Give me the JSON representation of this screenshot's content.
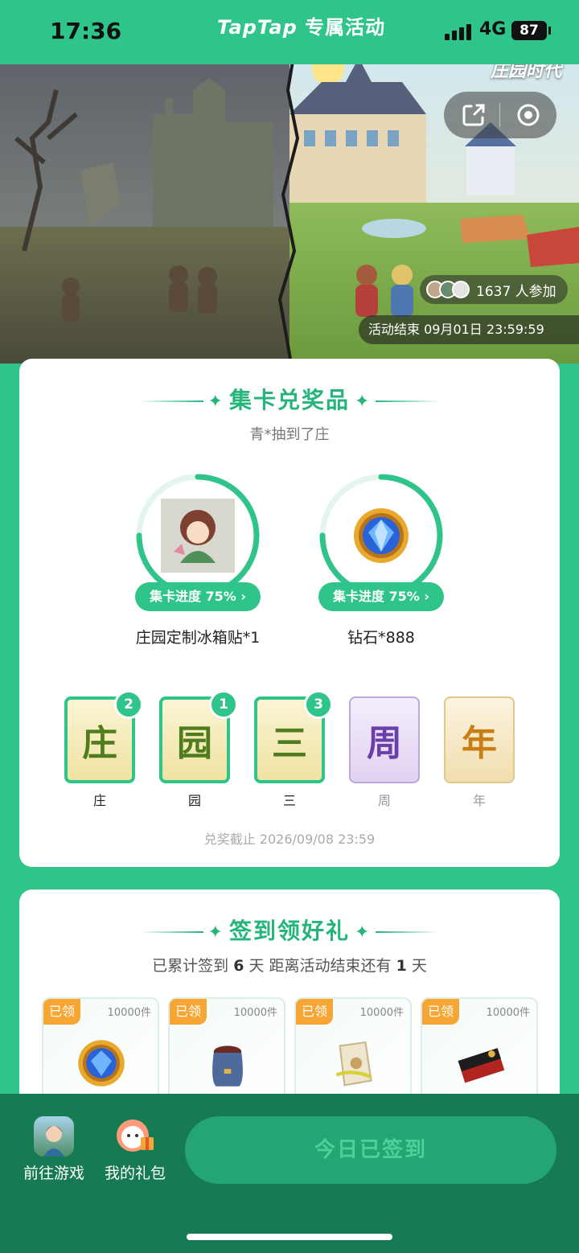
{
  "status": {
    "time": "17:36",
    "network": "4G",
    "battery": "87"
  },
  "brand": {
    "name": "TapTap",
    "suffix": "专属活动"
  },
  "hero": {
    "game_logo": "庄园时代",
    "participants": "1637 人参加",
    "end_time": "活动结束 09月01日 23:59:59"
  },
  "collect": {
    "title": "集卡兑奖品",
    "notice": "青*抽到了庄",
    "prizes": [
      {
        "progress_label": "集卡进度 75%",
        "progress": 0.75,
        "name": "庄园定制冰箱贴*1"
      },
      {
        "progress_label": "集卡进度 75%",
        "progress": 0.75,
        "name": "钻石*888"
      }
    ],
    "cards": [
      {
        "char": "庄",
        "label": "庄",
        "count": "2",
        "owned": true
      },
      {
        "char": "园",
        "label": "园",
        "count": "1",
        "owned": true
      },
      {
        "char": "三",
        "label": "三",
        "count": "3",
        "owned": true
      },
      {
        "char": "周",
        "label": "周",
        "owned": false
      },
      {
        "char": "年",
        "label": "年",
        "owned": false
      }
    ],
    "deadline": "兑奖截止 2026/09/08 23:59"
  },
  "signin": {
    "title": "签到领好礼",
    "summary_prefix": "已累计签到 ",
    "days_signed": "6",
    "summary_mid": " 天  距离活动结束还有 ",
    "days_left": "1",
    "summary_suffix": " 天",
    "gifts": [
      {
        "tag": "已领",
        "count": "10000件",
        "icon": "diamond-icon"
      },
      {
        "tag": "已领",
        "count": "10000件",
        "icon": "sack-icon"
      },
      {
        "tag": "已领",
        "count": "10000件",
        "icon": "seed-bag-icon"
      },
      {
        "tag": "已领",
        "count": "10000件",
        "icon": "envelope-icon"
      }
    ]
  },
  "bottom": {
    "go_game": "前往游戏",
    "my_gifts": "我的礼包",
    "signin_button": "今日已签到"
  },
  "colors": {
    "primary": "#2ec48a",
    "dark": "#167a52",
    "tag": "#f7a533"
  }
}
